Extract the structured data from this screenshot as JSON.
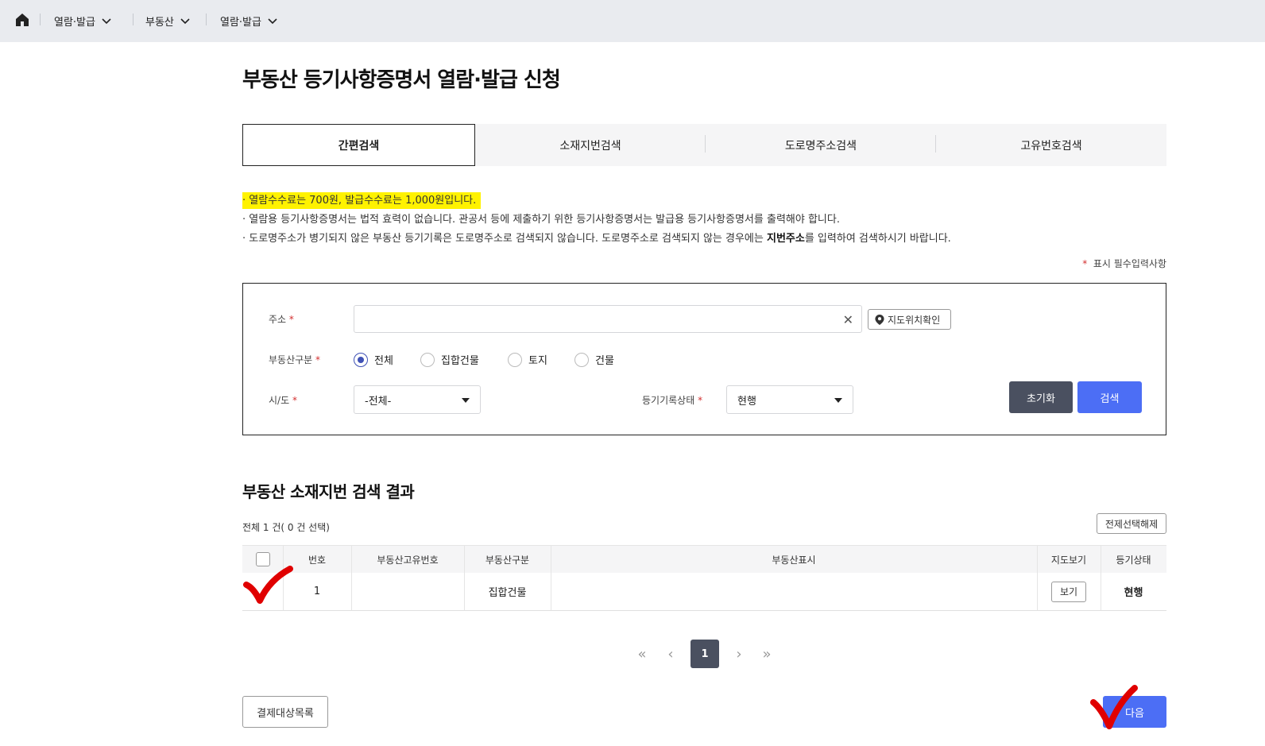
{
  "nav": {
    "items": [
      {
        "label": "열람·발급"
      },
      {
        "label": "부동산"
      },
      {
        "label": "열람·발급"
      }
    ]
  },
  "page": {
    "title": "부동산 등기사항증명서 열람·발급 신청"
  },
  "tabs": [
    {
      "label": "간편검색",
      "active": true
    },
    {
      "label": "소재지번검색"
    },
    {
      "label": "도로명주소검색"
    },
    {
      "label": "고유번호검색"
    }
  ],
  "notices": {
    "fee": "열람수수료는  700원, 발급수수료는  1,000원입니다.",
    "legal": "열람용 등기사항증명서는 법적 효력이 없습니다. 관공서 등에 제출하기 위한 등기사항증명서는 발급용 등기사항증명서를 출력해야 합니다.",
    "road_pre": "도로명주소가 병기되지 않은 부동산 등기기록은 도로명주소로 검색되지 않습니다. 도로명주소로 검색되지 않는 경우에는 ",
    "road_bold": "지번주소",
    "road_post": "를 입력하여 검색하시기 바랍니다."
  },
  "required_note": "표시 필수입력사항",
  "search": {
    "address_label": "주소",
    "address_value": "",
    "map_button": "지도위치확인",
    "type_label": "부동산구분",
    "types": [
      {
        "label": "전체",
        "checked": true
      },
      {
        "label": "집합건물"
      },
      {
        "label": "토지"
      },
      {
        "label": "건물"
      }
    ],
    "sido_label": "시/도",
    "sido_value": "-전체-",
    "status_label": "등기기록상태",
    "status_value": "현행",
    "reset_button": "초기화",
    "search_button": "검색"
  },
  "results": {
    "title": "부동산 소재지번 검색 결과",
    "count": "전체 1 건( 0 건 선택)",
    "deselect_button": "전제선택해제",
    "columns": [
      "번호",
      "부동산고유번호",
      "부동산구분",
      "부동산표시",
      "지도보기",
      "등기상태"
    ],
    "rows": [
      {
        "no": "1",
        "unique_no": "",
        "type": "집합건물",
        "display": "",
        "map_button": "보기",
        "status": "현행"
      }
    ]
  },
  "pagination": {
    "current": "1",
    "first": "«",
    "prev": "‹",
    "next": "›",
    "last": "»"
  },
  "footer": {
    "cart_button": "결제대상목록",
    "next_button": "다음"
  },
  "colors": {
    "primary": "#4c6ef5",
    "dark": "#4a5060",
    "highlight": "#fff200",
    "annotation": "#e00000"
  }
}
